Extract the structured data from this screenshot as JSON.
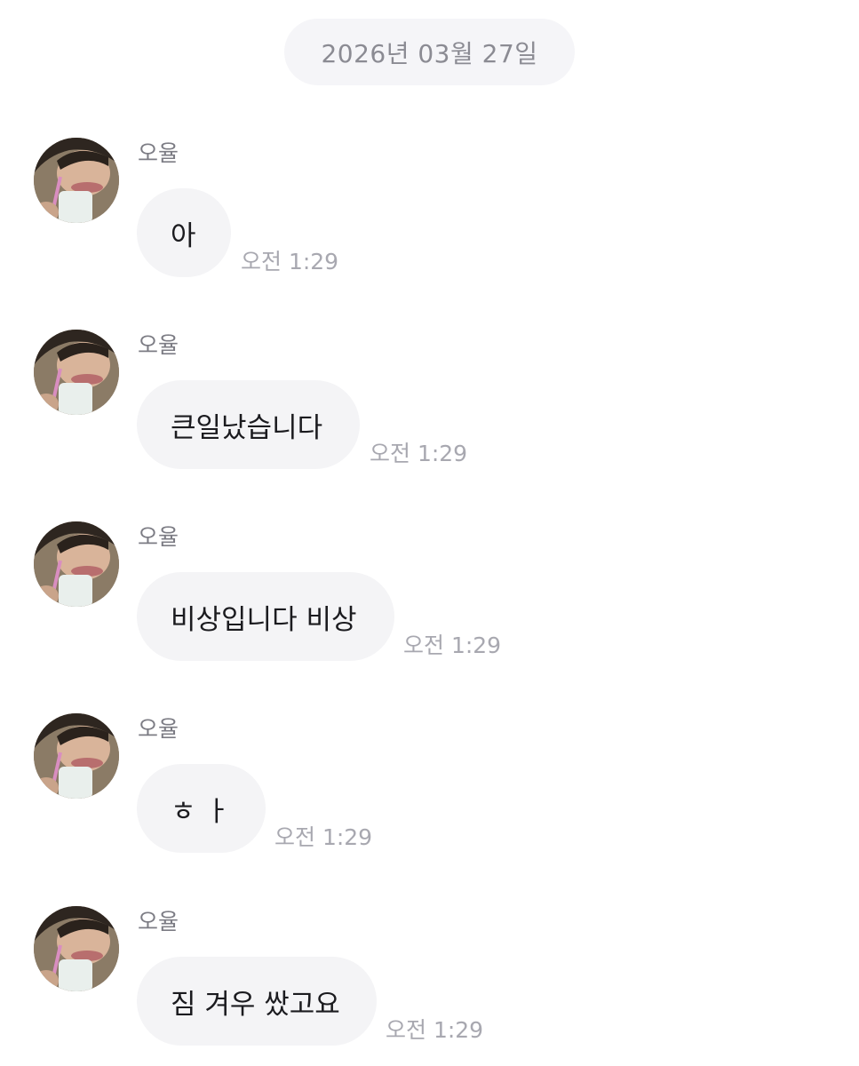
{
  "date_divider": "2026년 03월 27일",
  "messages": [
    {
      "sender": "오율",
      "text": "아",
      "time": "오전 1:29",
      "avatar": "profile-photo"
    },
    {
      "sender": "오율",
      "text": "큰일났습니다",
      "time": "오전 1:29",
      "avatar": "profile-photo"
    },
    {
      "sender": "오율",
      "text": "비상입니다 비상",
      "time": "오전 1:29",
      "avatar": "profile-photo"
    },
    {
      "sender": "오율",
      "text": "ㅎ ㅏ",
      "time": "오전 1:29",
      "avatar": "profile-photo"
    },
    {
      "sender": "오율",
      "text": "짐 겨우 쌌고요",
      "time": "오전 1:29",
      "avatar": "profile-photo"
    }
  ]
}
